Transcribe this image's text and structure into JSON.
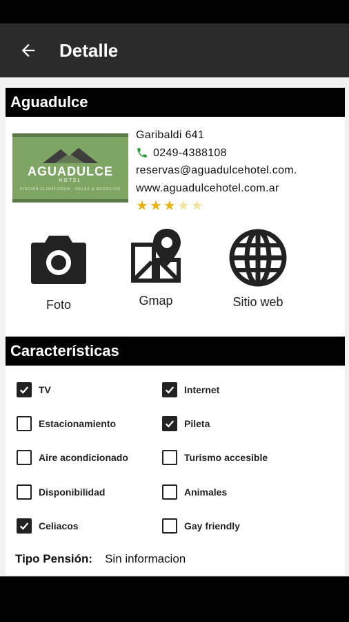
{
  "app_bar": {
    "title": "Detalle"
  },
  "hotel": {
    "name": "Aguadulce",
    "logo": {
      "name_light": "AGUA",
      "name_bold": "DULCE",
      "sub": "HOTEL",
      "tagline": "PISCINA CLIMATIZADA · RELAX & NEGOCIOS"
    },
    "address": "Garibaldi 641",
    "phone": "0249-4388108",
    "email": "reservas@aguadulcehotel.com.",
    "website": "www.aguadulcehotel.com.ar",
    "rating": 3,
    "rating_max": 5
  },
  "actions": [
    {
      "label": "Foto",
      "icon": "camera-icon"
    },
    {
      "label": "Gmap",
      "icon": "map-icon"
    },
    {
      "label": "Sitio web",
      "icon": "globe-icon"
    }
  ],
  "features": {
    "title": "Características",
    "items": [
      {
        "label": "TV",
        "checked": true
      },
      {
        "label": "Internet",
        "checked": true
      },
      {
        "label": "Estacionamiento",
        "checked": false
      },
      {
        "label": "Pileta",
        "checked": true
      },
      {
        "label": "Aire acondicionado",
        "checked": false
      },
      {
        "label": "Turismo accesible",
        "checked": false
      },
      {
        "label": "Disponibilidad",
        "checked": false
      },
      {
        "label": "Animales",
        "checked": false
      },
      {
        "label": "Celiacos",
        "checked": true
      },
      {
        "label": "Gay friendly",
        "checked": false
      }
    ],
    "pension_label": "Tipo Pensión:",
    "pension_value": "Sin informacion"
  },
  "colors": {
    "app_bar": "#2b2b2b",
    "header": "#000000",
    "phone_icon": "#2e9b3a",
    "star_on": "#e8b215",
    "star_off": "#f3e3a0",
    "logo_bg": "#7fa564"
  }
}
